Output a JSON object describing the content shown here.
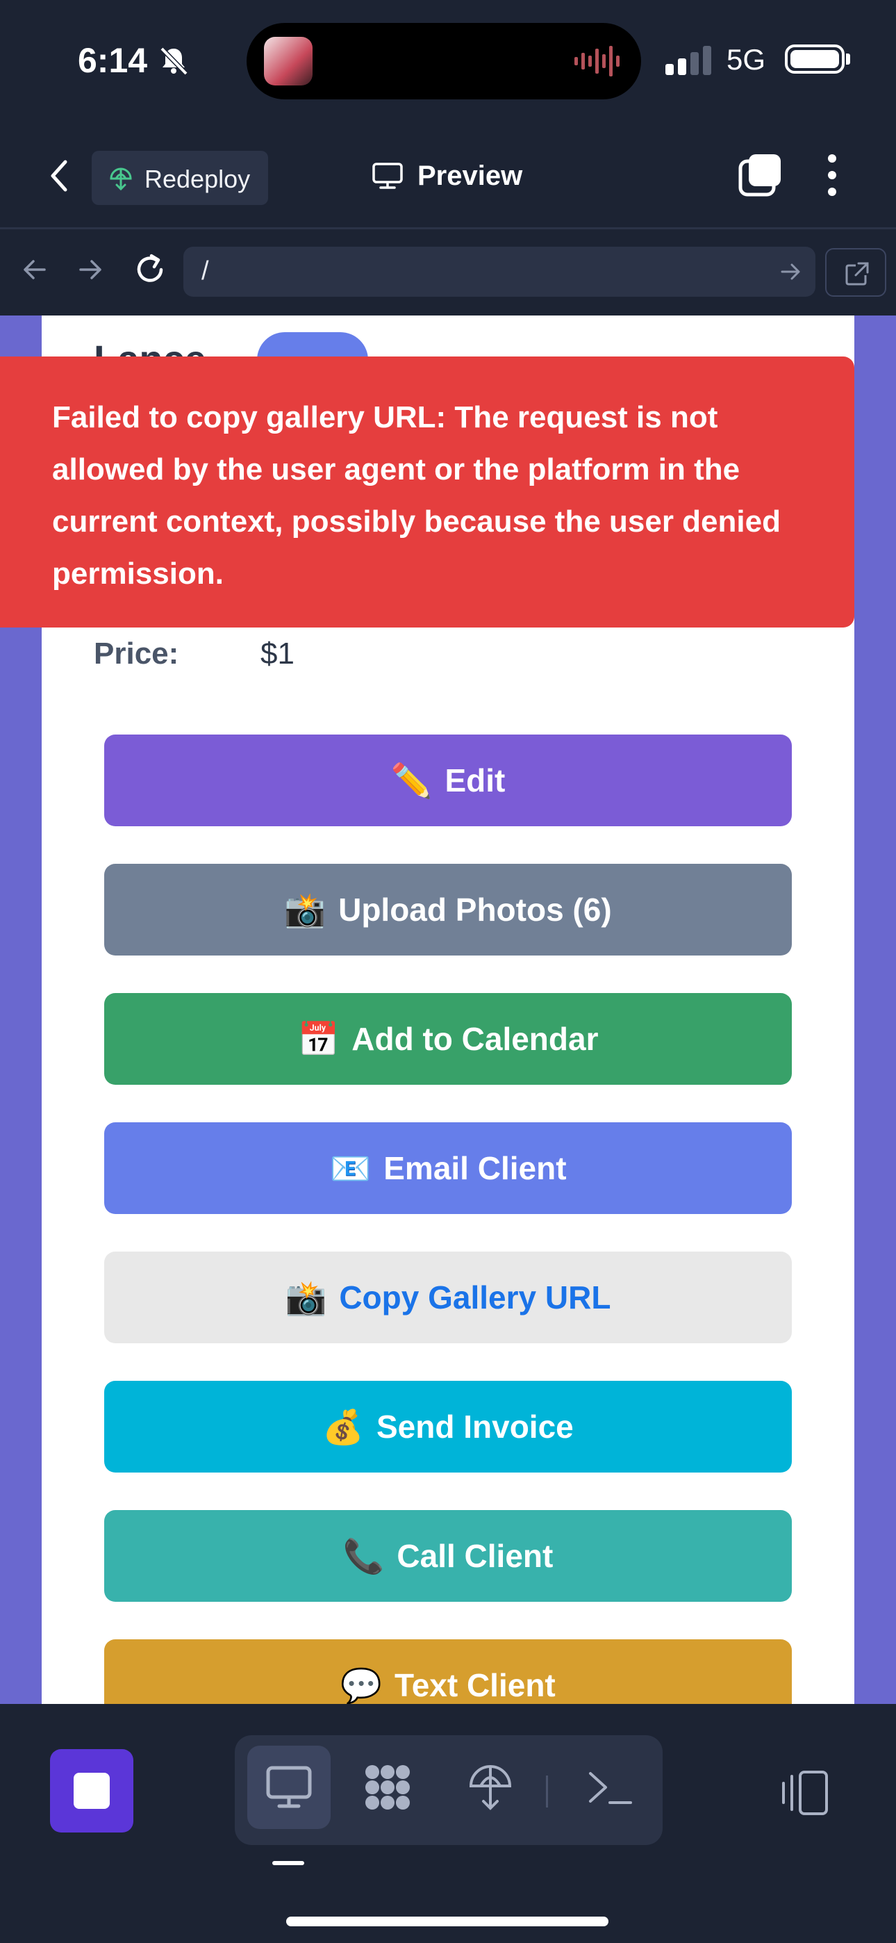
{
  "status_bar": {
    "time": "6:14",
    "network": "5G"
  },
  "header": {
    "redeploy_label": "Redeploy",
    "title": "Preview"
  },
  "url_bar": {
    "url": "/"
  },
  "page": {
    "heading_peek": "Lance",
    "price_label": "Price:",
    "price_value": "$1",
    "buttons": [
      {
        "emoji": "✏️",
        "label": "Edit",
        "color": "#7b5cd6"
      },
      {
        "emoji": "📸",
        "label": "Upload Photos (6)",
        "color": "#718096"
      },
      {
        "emoji": "📅",
        "label": "Add to Calendar",
        "color": "#38a169"
      },
      {
        "emoji": "📧",
        "label": "Email Client",
        "color": "#667eea"
      },
      {
        "emoji": "📸",
        "label": "Copy Gallery URL",
        "color": "#e8e8e8"
      },
      {
        "emoji": "💰",
        "label": "Send Invoice",
        "color": "#00b4d8"
      },
      {
        "emoji": "📞",
        "label": "Call Client",
        "color": "#38b2ac"
      },
      {
        "emoji": "💬",
        "label": "Text Client",
        "color": "#d69e2e"
      }
    ]
  },
  "toast": {
    "message": "Failed to copy gallery URL: The request is not allowed by the user agent or the platform in the current context, possibly because the user denied permission.",
    "color": "#e53e3e"
  },
  "toolbar": {
    "icons": [
      "stop-icon",
      "desktop-icon",
      "apps-icon",
      "deploy-icon",
      "terminal-icon",
      "split-view-icon"
    ],
    "accent": "#5b36d8"
  }
}
